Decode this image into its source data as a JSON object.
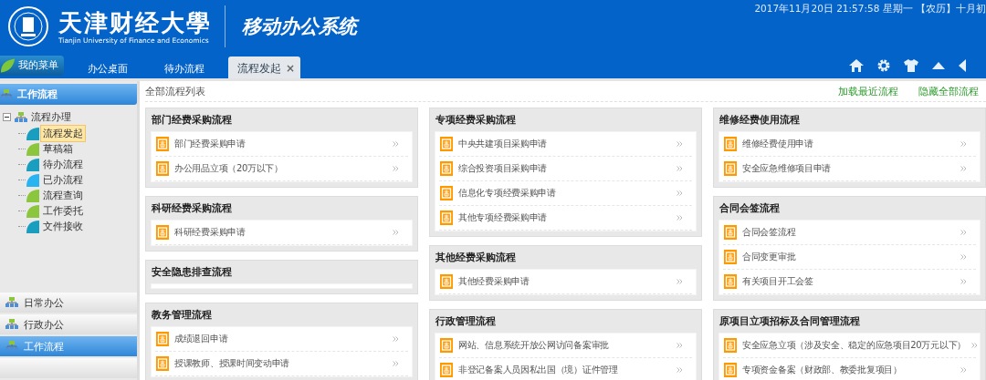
{
  "header": {
    "university_name": "天津财经大學",
    "university_name_en": "Tianjin University of Finance and Economics",
    "system_name": "移动办公系统",
    "datetime": "2017年11月20日  21:57:58 星期一 【农历】十月初"
  },
  "menu_button": {
    "label": "我的菜单"
  },
  "tabs": [
    {
      "label": "办公桌面",
      "selected": false
    },
    {
      "label": "待办流程",
      "selected": false
    },
    {
      "label": "流程发起",
      "selected": true,
      "close": "×"
    }
  ],
  "sidebar": {
    "title": "工作流程",
    "tree": [
      {
        "label": "流程办理",
        "expanded": true,
        "children": [
          {
            "label": "流程发起",
            "selected": true,
            "color": "#1a9ec0"
          },
          {
            "label": "草稿箱",
            "selected": false,
            "color": "#8cc63f"
          },
          {
            "label": "待办流程",
            "selected": false,
            "color": "#1a9ec0"
          },
          {
            "label": "已办流程",
            "selected": false,
            "color": "#27b4f0"
          },
          {
            "label": "流程查询",
            "selected": false,
            "color": "#8cc63f"
          },
          {
            "label": "工作委托",
            "selected": false,
            "color": "#8cc63f"
          },
          {
            "label": "文件接收",
            "selected": false,
            "color": "#1a9ec0"
          }
        ]
      }
    ],
    "sections": [
      {
        "label": "日常办公",
        "selected": false
      },
      {
        "label": "行政办公",
        "selected": false
      },
      {
        "label": "工作流程",
        "selected": true
      }
    ]
  },
  "main": {
    "title": "全部流程列表",
    "links": [
      "加载最近流程",
      "隐藏全部流程"
    ],
    "columns": [
      [
        {
          "title": "部门经费采购流程",
          "items": [
            "部门经费采购申请",
            "办公用品立项（20万以下）"
          ]
        },
        {
          "title": "科研经费采购流程",
          "items": [
            "科研经费采购申请"
          ]
        },
        {
          "title": "安全隐患排查流程"
        },
        {
          "title": "教务管理流程",
          "items": [
            "成绩退回申请",
            "授课教师、授课时间变动申请"
          ]
        }
      ],
      [
        {
          "title": "专项经费采购流程",
          "items": [
            "中央共建项目采购申请",
            "综合投资项目采购申请",
            "信息化专项经费采购申请",
            "其他专项经费采购申请"
          ]
        },
        {
          "title": "其他经费采购流程",
          "items": [
            "其他经费采购申请"
          ]
        },
        {
          "title": "行政管理流程",
          "items": [
            "网站、信息系统开放公网访问备案审批",
            "非登记备案人员因私出国（境）证件管理"
          ]
        }
      ],
      [
        {
          "title": "维修经费使用流程",
          "items": [
            "维修经费使用申请",
            "安全应急维修项目申请"
          ]
        },
        {
          "title": "合同会签流程",
          "items": [
            "合同会签流程",
            "合同变更审批",
            "有关项目开工会签"
          ]
        },
        {
          "title": "原项目立项招标及合同管理流程",
          "items": [
            "安全应急立项（涉及安全、稳定的应急项目20万元以下）",
            "专项资金备案（财政部、教委批复项目）"
          ]
        }
      ]
    ]
  }
}
